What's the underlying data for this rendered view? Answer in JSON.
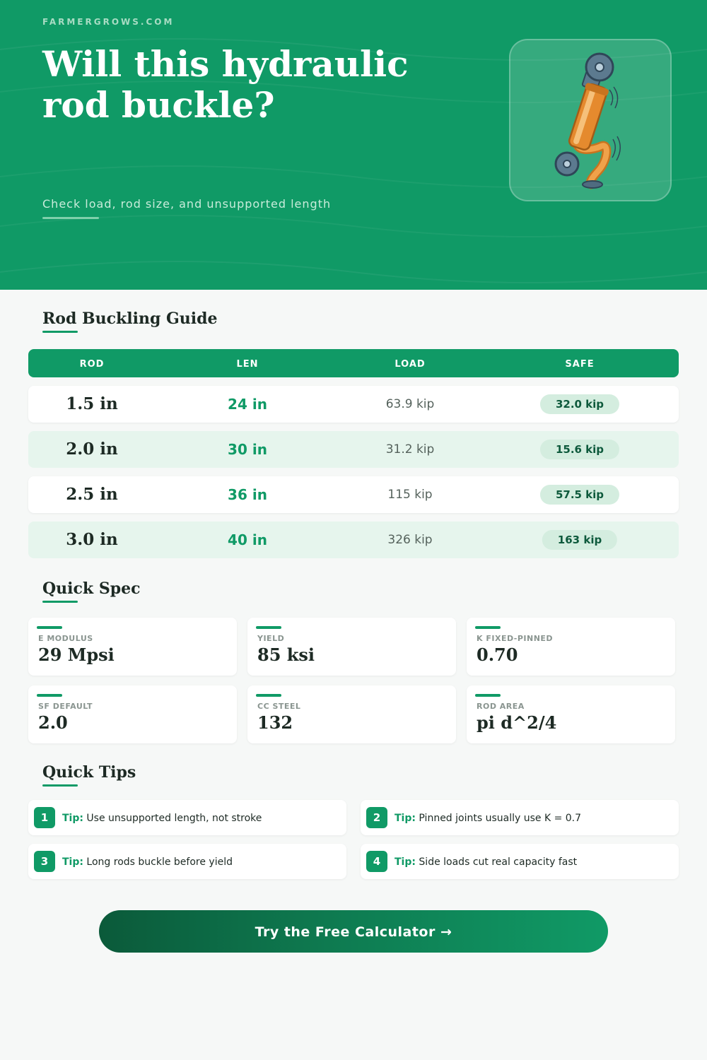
{
  "header": {
    "site": "FARMERGROWS.COM",
    "title": "Will this hydraulic rod buckle?",
    "subtitle": "Check load, rod size, and unsupported length"
  },
  "guide": {
    "heading": "Rod Buckling Guide",
    "columns": [
      "ROD",
      "LEN",
      "LOAD",
      "SAFE"
    ],
    "rows": [
      {
        "rod": "1.5 in",
        "len": "24 in",
        "load": "63.9 kip",
        "safe": "32.0 kip"
      },
      {
        "rod": "2.0 in",
        "len": "30 in",
        "load": "31.2 kip",
        "safe": "15.6 kip"
      },
      {
        "rod": "2.5 in",
        "len": "36 in",
        "load": "115 kip",
        "safe": "57.5 kip"
      },
      {
        "rod": "3.0 in",
        "len": "40 in",
        "load": "326 kip",
        "safe": "163 kip"
      }
    ]
  },
  "spec": {
    "heading": "Quick Spec",
    "items": [
      {
        "label": "E MODULUS",
        "value": "29 Mpsi"
      },
      {
        "label": "YIELD",
        "value": "85 ksi"
      },
      {
        "label": "K FIXED-PINNED",
        "value": "0.70"
      },
      {
        "label": "SF DEFAULT",
        "value": "2.0"
      },
      {
        "label": "CC STEEL",
        "value": "132"
      },
      {
        "label": "ROD AREA",
        "value": "pi d^2/4"
      }
    ]
  },
  "tips": {
    "heading": "Quick Tips",
    "items": [
      {
        "num": "1",
        "prefix": "Tip:",
        "text": "Use unsupported length, not stroke"
      },
      {
        "num": "2",
        "prefix": "Tip:",
        "text": "Pinned joints usually use K = 0.7"
      },
      {
        "num": "3",
        "prefix": "Tip:",
        "text": "Long rods buckle before yield"
      },
      {
        "num": "4",
        "prefix": "Tip:",
        "text": "Side loads cut real capacity fast"
      }
    ]
  },
  "cta": {
    "label": "Try the Free Calculator →"
  },
  "icons": {
    "illustration": "bent-hydraulic-cylinder-icon"
  },
  "colors": {
    "brand": "#109a66",
    "brand_dark": "#0b5a3a",
    "accent": "#f0a24a",
    "text": "#1d2a24"
  }
}
